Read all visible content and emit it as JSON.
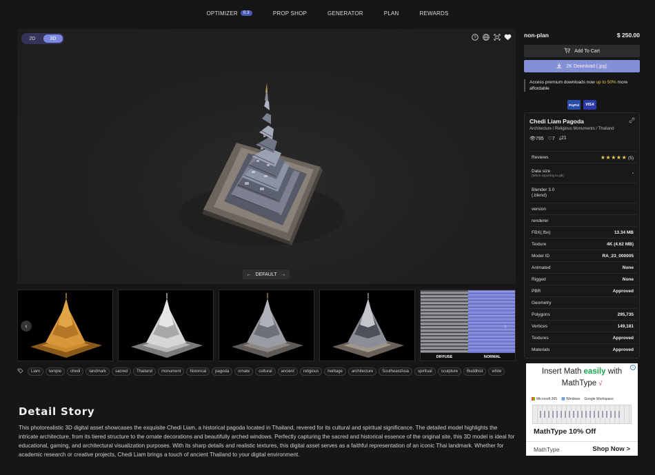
{
  "nav": {
    "items": [
      "OPTIMIZER",
      "PROP SHOP",
      "GENERATOR",
      "PLAN",
      "REWARDS"
    ],
    "optimizer_badge": "0.3"
  },
  "viewer": {
    "toggle_2d": "2D",
    "toggle_3d": "3D",
    "active_mode": "3D",
    "icons": [
      "help-icon",
      "globe-icon",
      "fullscreen-icon",
      "heart-icon"
    ],
    "preset_label": "DEFAULT"
  },
  "thumbnails": {
    "map_labels": [
      "DIFFUSE",
      "NORMAL"
    ]
  },
  "tags": [
    "Liam",
    "temple",
    "chedi",
    "landmark",
    "sacred",
    "Thailand",
    "monument",
    "historical",
    "pagoda",
    "ornate",
    "cultural",
    "ancient",
    "religious",
    "heritage",
    "architecture",
    "SoutheastAsia",
    "spiritual",
    "sculpture",
    "Buddhist",
    "white"
  ],
  "story": {
    "title": "Detail Story",
    "text": "This photorealistic 3D digital asset showcases the exquisite Chedi Liam, a historical pagoda located in Thailand, revered for its cultural and spiritual significance. The detailed model highlights the intricate architecture, from its tiered structure to the ornate decorations and beautifully arched windows. Perfectly capturing the sacred and historical essence of the original site, this 3D model is ideal for educational, gaming, and architectural visualization purposes. With its sharp details and realistic textures, this digital asset serves as a faithful representation of an iconic Thai landmark. Whether for academic research or creative projects, Chedi Liam brings a touch of ancient Thailand to your digital environment."
  },
  "purchase": {
    "plan": "non-plan",
    "price": "$ 250.00",
    "cart_label": "Add To Cart",
    "download_label": "2K Download (.jpg)",
    "premium_pre": "Access premium downloads now ",
    "premium_highlight": "up to 50%",
    "premium_post": " more affordable",
    "payments": [
      "PayPal",
      "VISA"
    ]
  },
  "asset": {
    "title": "Chedi Liam Pagoda",
    "breadcrumb": "Architecture / Religious Monuments / Thailand",
    "views": "795",
    "likes": "7",
    "downloads": "21",
    "reviews_label": "Reviews",
    "reviews_count": "(5)",
    "rating": 5,
    "props": [
      {
        "label": "Data size",
        "sub": "(When exporting to glb)",
        "value": "-"
      },
      {
        "label": "Blender 3.0 (.blend)",
        "value": ""
      },
      {
        "label": "version",
        "value": ""
      },
      {
        "label": "renderer",
        "value": ""
      },
      {
        "label": "FBX(.fbx)",
        "value": "13.34 MB"
      },
      {
        "label": "Texture",
        "value": "4K (4.62 MB)"
      },
      {
        "label": "Model ID",
        "value": "RA_23_000005"
      },
      {
        "label": "Animated",
        "value": "None"
      },
      {
        "label": "Rigged",
        "value": "None"
      },
      {
        "label": "PBR",
        "value": "Approved"
      },
      {
        "label": "Geometry",
        "value": ""
      },
      {
        "label": "Polygons",
        "value": "295,735"
      },
      {
        "label": "Vertices",
        "value": "149,181"
      },
      {
        "label": "Textures",
        "value": "Approved"
      },
      {
        "label": "Materials",
        "value": "Approved"
      }
    ]
  },
  "ad": {
    "head_pre": "Insert Math ",
    "head_highlight": "easily",
    "head_post": " with",
    "product": "MathType",
    "brands": [
      "Microsoft 365",
      "Windows",
      "Google Workspace"
    ],
    "title": "MathType 10% Off",
    "brand": "MathType",
    "cta": "Shop Now >"
  }
}
